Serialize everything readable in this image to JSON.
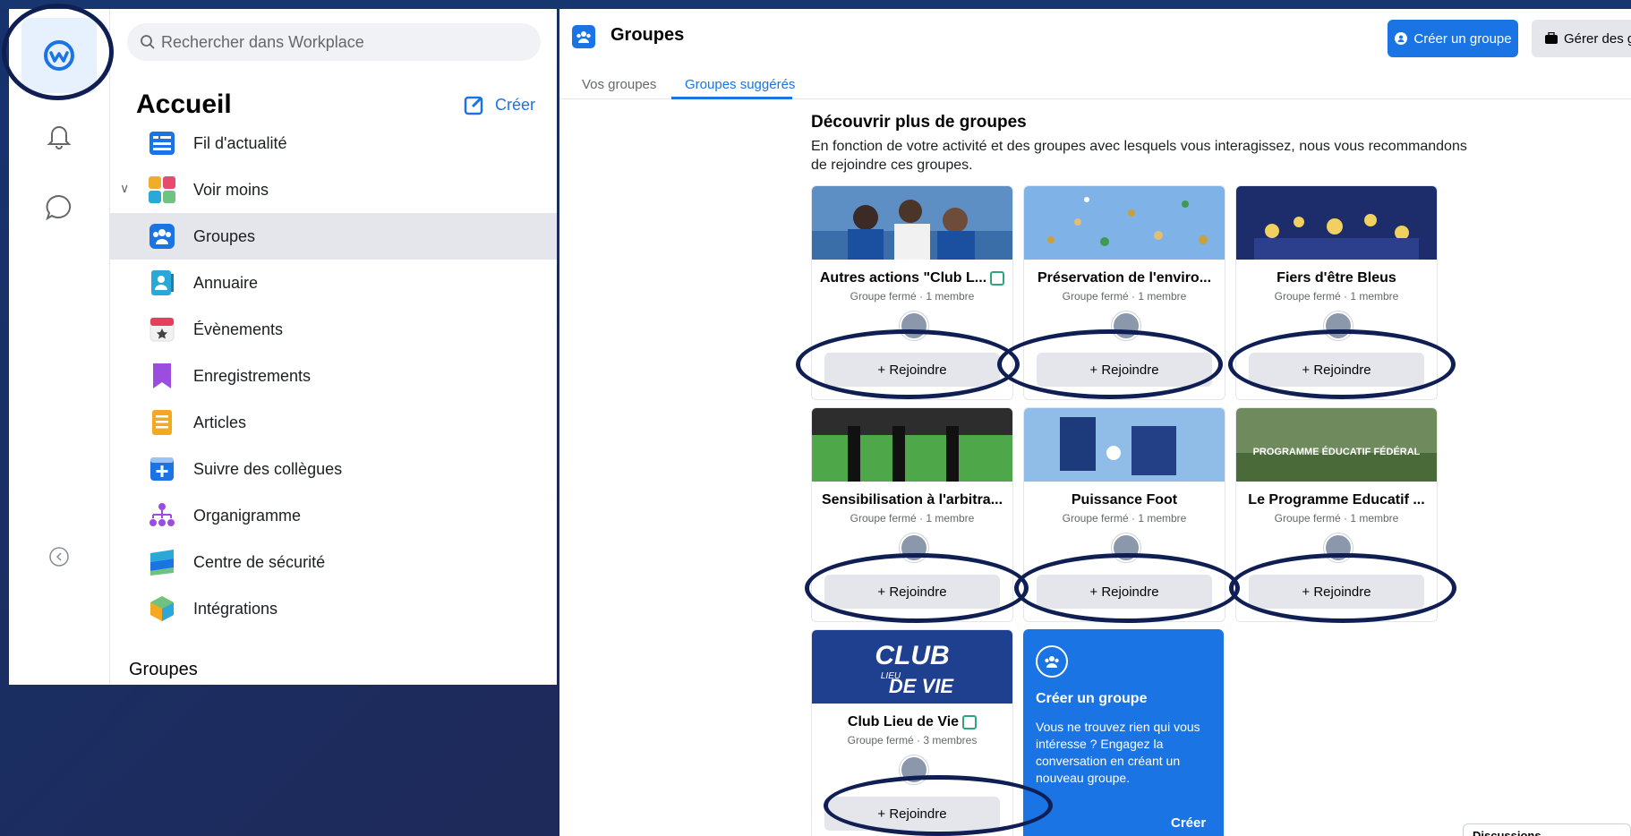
{
  "sidebar": {
    "search_placeholder": "Rechercher dans Workplace",
    "home_title": "Accueil",
    "create_label": "Créer",
    "items": [
      {
        "label": "Fil d'actualité",
        "icon": "news-feed-icon"
      },
      {
        "label": "Voir moins",
        "icon": "apps-icon"
      },
      {
        "label": "Groupes",
        "icon": "groups-icon"
      },
      {
        "label": "Annuaire",
        "icon": "directory-icon"
      },
      {
        "label": "Évènements",
        "icon": "events-icon"
      },
      {
        "label": "Enregistrements",
        "icon": "bookmark-icon"
      },
      {
        "label": "Articles",
        "icon": "articles-icon"
      },
      {
        "label": "Suivre des collègues",
        "icon": "follow-icon"
      },
      {
        "label": "Organigramme",
        "icon": "org-chart-icon"
      },
      {
        "label": "Centre de sécurité",
        "icon": "security-center-icon"
      },
      {
        "label": "Intégrations",
        "icon": "integrations-icon"
      }
    ],
    "groups_heading": "Groupes"
  },
  "header": {
    "title": "Groupes",
    "create_group_label": "Créer un groupe",
    "manage_label": "Gérer des gr"
  },
  "tabs": [
    {
      "label": "Vos groupes"
    },
    {
      "label": "Groupes suggérés"
    }
  ],
  "discover": {
    "title": "Découvrir plus de groupes",
    "description": "En fonction de votre activité et des groupes avec lesquels vous interagissez, nous vous recommandons de rejoindre ces groupes."
  },
  "groups": [
    {
      "name": "Autres actions \"Club L...",
      "meta": "Groupe fermé · 1 membre",
      "verified": true
    },
    {
      "name": "Préservation de l'enviro...",
      "meta": "Groupe fermé · 1 membre",
      "verified": false
    },
    {
      "name": "Fiers d'être Bleus",
      "meta": "Groupe fermé · 1 membre",
      "verified": false
    },
    {
      "name": "Sensibilisation à l'arbitra...",
      "meta": "Groupe fermé · 1 membre",
      "verified": false
    },
    {
      "name": "Puissance Foot",
      "meta": "Groupe fermé · 1 membre",
      "verified": false
    },
    {
      "name": "Le Programme Educatif ...",
      "meta": "Groupe fermé · 1 membre",
      "verified": false
    },
    {
      "name": "Club Lieu de Vie",
      "meta": "Groupe fermé · 3 membres",
      "verified": true
    }
  ],
  "join_label": "+ Rejoindre",
  "create_card": {
    "title": "Créer un groupe",
    "text": "Vous ne trouvez rien qui vous intéresse ? Engagez la conversation en créant un nouveau groupe.",
    "button": "Créer"
  },
  "thumbnail_texts": {
    "club_title": "CLUB",
    "club_subtitle": "DE VIE",
    "club_small": "LIEU",
    "programme": "PROGRAMME ÉDUCATIF FÉDÉRAL"
  },
  "chat": {
    "label": "Discussions"
  },
  "colors": {
    "accent": "#1b74e4",
    "annotation": "#0f1f54",
    "background": "#1b2d5e"
  }
}
